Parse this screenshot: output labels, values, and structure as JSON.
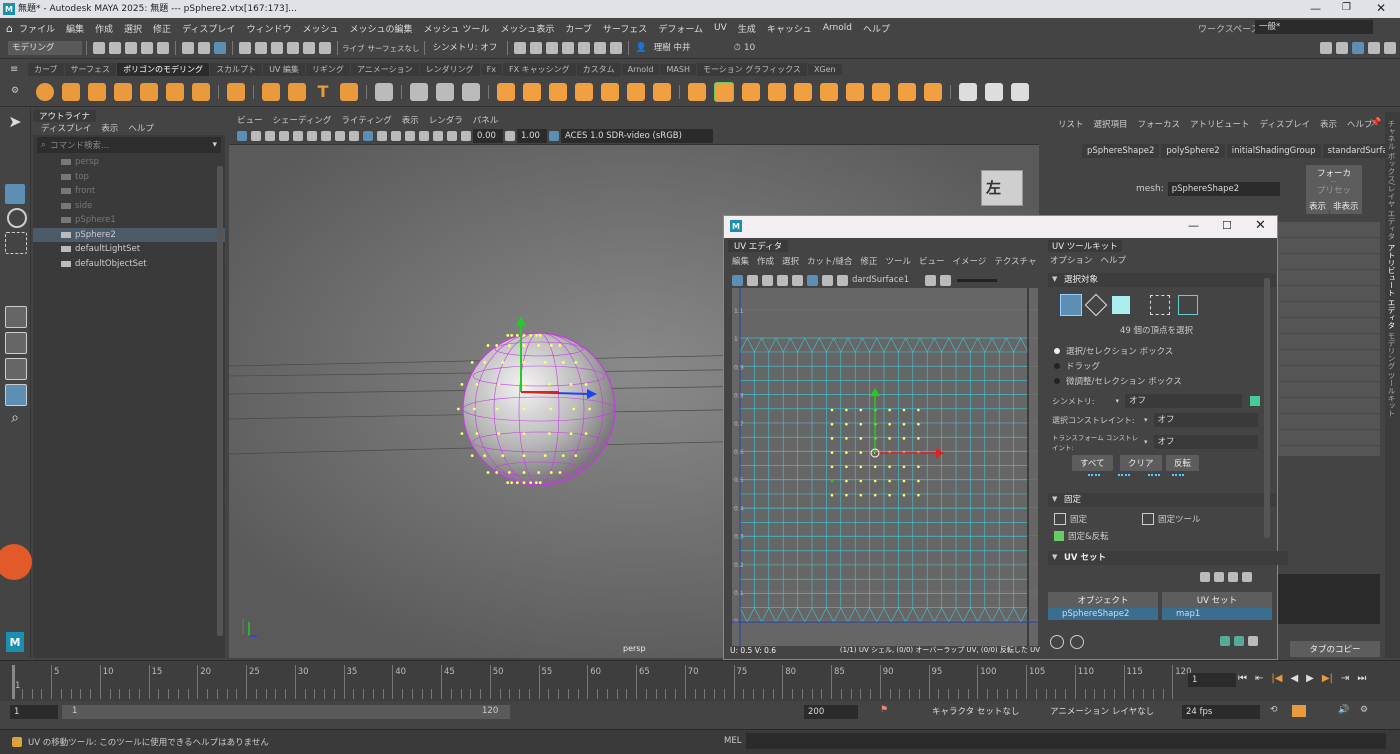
{
  "window": {
    "title": "無題* - Autodesk MAYA 2025: 無題   ---   pSphere2.vtx[167:173]...",
    "workspace_label": "ワークスペース :",
    "workspace_value": "一般*"
  },
  "menu": [
    "ファイル",
    "編集",
    "作成",
    "選択",
    "修正",
    "ディスプレイ",
    "ウィンドウ",
    "メッシュ",
    "メッシュの編集",
    "メッシュ ツール",
    "メッシュ表示",
    "カーブ",
    "サーフェス",
    "デフォーム",
    "UV",
    "生成",
    "キャッシュ",
    "Arnold",
    "ヘルプ"
  ],
  "status": {
    "mode": "モデリング",
    "live": "ライブ",
    "live_surface": "サーフェスなし",
    "symmetry": "シンメトリ: オフ",
    "user": "理樹 中井",
    "count": "10"
  },
  "shelf": {
    "tabs": [
      "カーブ",
      "サーフェス",
      "ポリゴンのモデリング",
      "スカルプト",
      "UV 編集",
      "リギング",
      "アニメーション",
      "レンダリング",
      "Fx",
      "FX キャッシング",
      "カスタム",
      "Arnold",
      "MASH",
      "モーション グラフィックス",
      "XGen"
    ],
    "active": 2
  },
  "outliner": {
    "tab": "アウトライナ",
    "menu": [
      "ディスプレイ",
      "表示",
      "ヘルプ"
    ],
    "search_placeholder": "コマンド検索...",
    "items": [
      {
        "label": "persp",
        "dim": true
      },
      {
        "label": "top",
        "dim": true
      },
      {
        "label": "front",
        "dim": true
      },
      {
        "label": "side",
        "dim": true
      },
      {
        "label": "pSphere1",
        "dim": true
      },
      {
        "label": "pSphere2",
        "sel": true
      },
      {
        "label": "defaultLightSet"
      },
      {
        "label": "defaultObjectSet"
      }
    ]
  },
  "viewport": {
    "menu": [
      "ビュー",
      "シェーディング",
      "ライティング",
      "表示",
      "レンダラ",
      "パネル"
    ],
    "val1": "0.00",
    "val2": "1.00",
    "colorspace": "ACES 1.0 SDR-video (sRGB)",
    "camera": "persp",
    "cube_label": "左"
  },
  "attr": {
    "menu": [
      "リスト",
      "選択項目",
      "フォーカス",
      "アトリビュート",
      "ディスプレイ",
      "表示",
      "ヘルプ"
    ],
    "tabs": [
      "pSphereShape2",
      "polySphere2",
      "initialShadingGroup",
      "standardSurface1"
    ],
    "mesh_label": "mesh:",
    "mesh_value": "pSphereShape2",
    "focus_btn": "フォーカス",
    "preset_btn": "プリセット",
    "show_btn": "表示",
    "hide_btn": "非表示",
    "copy_tab": "タブのコピー"
  },
  "sidetabs": [
    "チャネル ボックス/レイヤ エディタ",
    "アトリビュート エディタ",
    "モデリング ツールキット"
  ],
  "uv_editor": {
    "tab": "UV エディタ",
    "menu": [
      "編集",
      "作成",
      "選択",
      "カット/縫合",
      "修正",
      "ツール",
      "ビュー",
      "イメージ",
      "テクスチャ"
    ],
    "shader": "dardSurface1",
    "coords": "U: 0.5 V: 0.6",
    "status_text": "(1/1) UV シェル, (0/0) オーバーラップ UV, (0/0) 反転した UV",
    "axis": [
      "1.1",
      "1",
      "0.9",
      "0.8",
      "0.7",
      "0.6",
      "0.5",
      "0.4",
      "0.3",
      "0.2",
      "0.1",
      "0"
    ]
  },
  "uv_toolkit": {
    "tab": "UV ツールキット",
    "menu": [
      "オプション",
      "ヘルプ"
    ],
    "sel_section": "選択対象",
    "vert_count": "49 個の頂点を選択",
    "radios": [
      "選択/セレクション ボックス",
      "ドラッグ",
      "微調整/セレクション ボックス"
    ],
    "symmetry_label": "シンメトリ:",
    "symmetry_value": "オフ",
    "constraint_label": "選択コンストレイント:",
    "constraint_value": "オフ",
    "transform_label": "トランスフォーム コンストレイント:",
    "transform_value": "オフ",
    "btn_all": "すべて",
    "btn_clear": "クリア",
    "btn_invert": "反転",
    "pin_section": "固定",
    "pin": "固定",
    "pin_tool": "固定ツール",
    "pin_invert": "固定&反転",
    "uvset_section": "UV セット",
    "col_object": "オブジェクト",
    "col_uvset": "UV セット",
    "row_object": "pSphereShape2",
    "row_uvset": "map1"
  },
  "timeline": {
    "ticks": [
      "1",
      "5",
      "10",
      "15",
      "20",
      "25",
      "30",
      "35",
      "40",
      "45",
      "50",
      "55",
      "60",
      "65",
      "70",
      "75",
      "80",
      "85",
      "90",
      "95",
      "100",
      "105",
      "110",
      "115",
      "120"
    ],
    "current": "1"
  },
  "range": {
    "start": "1",
    "inner_start": "1",
    "inner_end": "120",
    "end": "200",
    "char_set": "キャラクタ セットなし",
    "anim_layer": "アニメーション レイヤなし",
    "fps": "24 fps"
  },
  "help": {
    "text": "UV の移動ツール: このツールに使用できるヘルプはありません",
    "mel": "MEL"
  }
}
